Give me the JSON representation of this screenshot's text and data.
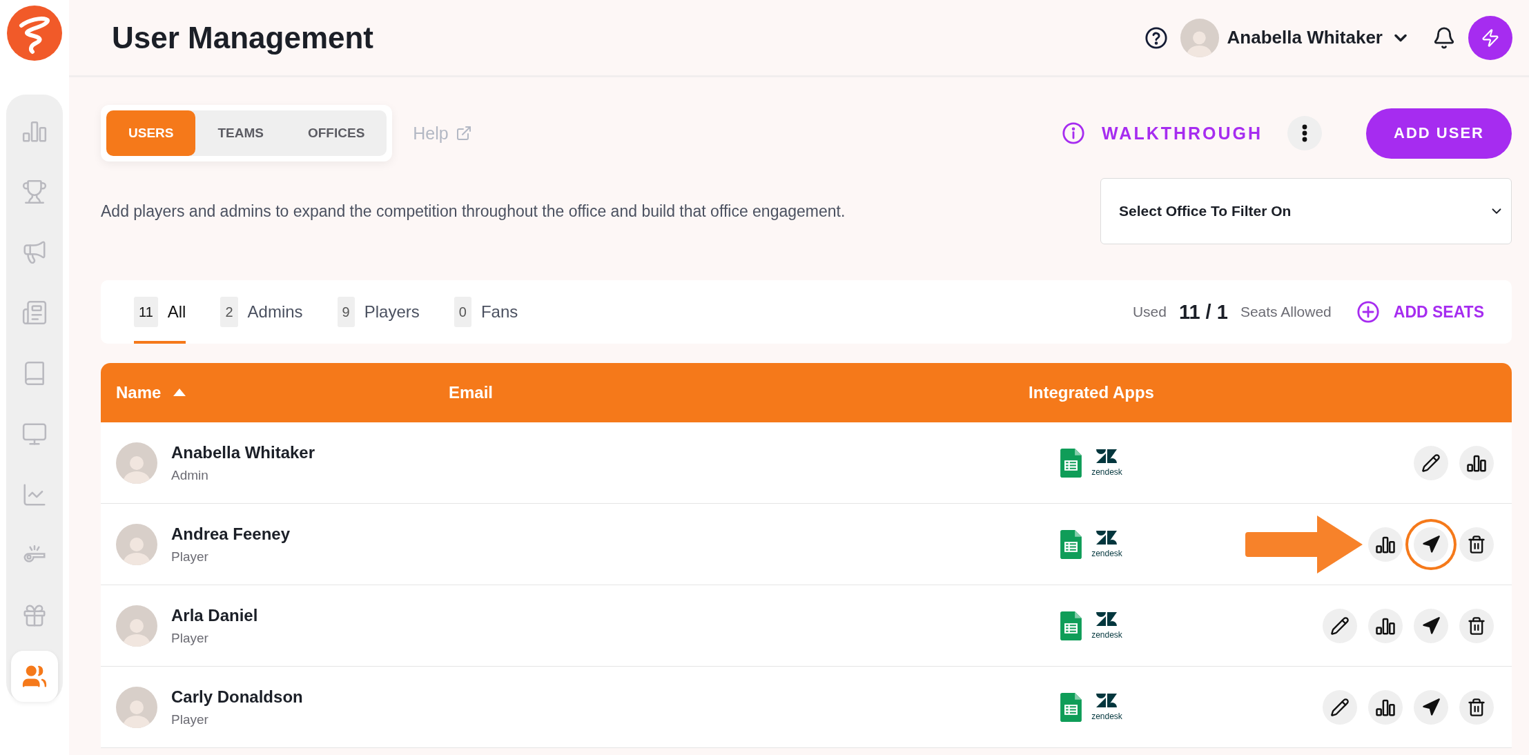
{
  "sidebar": {
    "items": [
      {
        "kind": "bars",
        "selected": false
      },
      {
        "kind": "trophy",
        "selected": false
      },
      {
        "kind": "megaphone",
        "selected": false
      },
      {
        "kind": "newspaper",
        "selected": false
      },
      {
        "kind": "book",
        "selected": false
      },
      {
        "kind": "monitor",
        "selected": false
      },
      {
        "kind": "line-chart",
        "selected": false
      },
      {
        "kind": "whistle",
        "selected": false
      },
      {
        "kind": "gift",
        "selected": false
      },
      {
        "kind": "users",
        "selected": true
      }
    ]
  },
  "header": {
    "title": "User Management",
    "user_name": "Anabella Whitaker"
  },
  "section_tabs": [
    {
      "label": "USERS",
      "selected": true
    },
    {
      "label": "TEAMS",
      "selected": false
    },
    {
      "label": "OFFICES",
      "selected": false
    }
  ],
  "help_link": "Help",
  "walkthrough": "WALKTHROUGH",
  "add_user": "ADD USER",
  "description": "Add players and admins to expand the competition throughout the office and build that office engagement.",
  "office_filter": {
    "value": "Select Office To Filter On"
  },
  "role_filters": [
    {
      "count": "11",
      "label": "All",
      "selected": true
    },
    {
      "count": "2",
      "label": "Admins",
      "selected": false
    },
    {
      "count": "9",
      "label": "Players",
      "selected": false
    },
    {
      "count": "0",
      "label": "Fans",
      "selected": false
    }
  ],
  "seats": {
    "used_label": "Used",
    "count": "11 / 1",
    "allowed_label": "Seats Allowed",
    "add_label": "ADD SEATS"
  },
  "table": {
    "columns": [
      {
        "label": "Name",
        "sorted": true
      },
      {
        "label": "Email",
        "sorted": false
      },
      {
        "label": "Integrated Apps",
        "sorted": false
      }
    ],
    "rows": [
      {
        "name": "Anabella Whitaker",
        "role": "Admin",
        "apps": [
          {
            "kind": "sheets"
          },
          {
            "kind": "zendesk",
            "label": "zendesk"
          }
        ],
        "pointer_arrow": false,
        "actions": [
          {
            "kind": "edit",
            "highlighted": false
          },
          {
            "kind": "stats",
            "highlighted": false
          }
        ]
      },
      {
        "name": "Andrea Feeney",
        "role": "Player",
        "apps": [
          {
            "kind": "sheets"
          },
          {
            "kind": "zendesk",
            "label": "zendesk"
          }
        ],
        "pointer_arrow": true,
        "actions": [
          {
            "kind": "stats",
            "highlighted": false
          },
          {
            "kind": "send",
            "highlighted": true
          },
          {
            "kind": "delete",
            "highlighted": false
          }
        ]
      },
      {
        "name": "Arla Daniel",
        "role": "Player",
        "apps": [
          {
            "kind": "sheets"
          },
          {
            "kind": "zendesk",
            "label": "zendesk"
          }
        ],
        "pointer_arrow": false,
        "actions": [
          {
            "kind": "edit",
            "highlighted": false
          },
          {
            "kind": "stats",
            "highlighted": false
          },
          {
            "kind": "send",
            "highlighted": false
          },
          {
            "kind": "delete",
            "highlighted": false
          }
        ]
      },
      {
        "name": "Carly Donaldson",
        "role": "Player",
        "apps": [
          {
            "kind": "sheets"
          },
          {
            "kind": "zendesk",
            "label": "zendesk"
          }
        ],
        "pointer_arrow": false,
        "actions": [
          {
            "kind": "edit",
            "highlighted": false
          },
          {
            "kind": "stats",
            "highlighted": false
          },
          {
            "kind": "send",
            "highlighted": false
          },
          {
            "kind": "delete",
            "highlighted": false
          }
        ]
      }
    ]
  }
}
